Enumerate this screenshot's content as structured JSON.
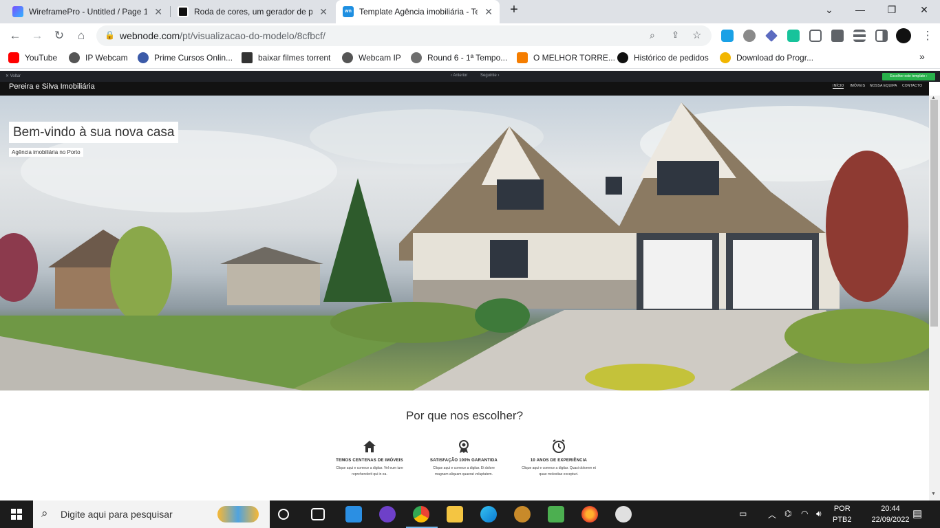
{
  "browser": {
    "tabs": [
      {
        "title": "WireframePro - Untitled / Page 1",
        "icon": "wireframepro-icon",
        "active": false
      },
      {
        "title": "Roda de cores, um gerador de pa",
        "icon": "canva-icon",
        "active": false
      },
      {
        "title": "Template Agência imobiliária - Te",
        "icon": "webnode-icon",
        "active": true
      }
    ],
    "new_tab": "+",
    "url_domain": "webnode.com",
    "url_path": "/pt/visualizacao-do-modelo/8cfbcf/",
    "bookmarks": [
      {
        "label": "YouTube",
        "color": "#ff0000"
      },
      {
        "label": "IP Webcam",
        "color": "#555555"
      },
      {
        "label": "Prime Cursos Onlin...",
        "color": "#3b5aa8"
      },
      {
        "label": "baixar filmes torrent",
        "color": "#333333"
      },
      {
        "label": "Webcam IP",
        "color": "#555555"
      },
      {
        "label": "Round 6 - 1ª Tempo...",
        "color": "#6e6e6e"
      },
      {
        "label": "O MELHOR TORRE...",
        "color": "#f57d00"
      },
      {
        "label": "Histórico de pedidos",
        "color": "#111111"
      },
      {
        "label": "Download do Progr...",
        "color": "#f2b600"
      }
    ]
  },
  "preview": {
    "back": "✕ Voltar",
    "prev": "‹ Anterior",
    "next": "Seguinte ›",
    "choose": "Escolher este template ›"
  },
  "site": {
    "brand": "Pereira e Silva Imobiliária",
    "nav": [
      "INÍCIO",
      "IMÓVEIS",
      "NOSSA EQUIPA",
      "CONTACTO"
    ],
    "hero_title": "Bem-vindo à sua nova casa",
    "hero_subtitle": "Agência imobiliária no Porto",
    "why_title": "Por que nos escolher?",
    "features": [
      {
        "icon": "house-icon",
        "heading": "TEMOS CENTENAS DE IMÓVEIS",
        "text1": "Clique aqui e comece a digitar. Vel eum iure",
        "text2": "reprehenderit qui in ea."
      },
      {
        "icon": "award-icon",
        "heading": "SATISFAÇÃO 100% GARANTIDA",
        "text1": "Clique aqui e comece a digitar. Et dolore",
        "text2": "magnam aliquam quaerat voluptatem."
      },
      {
        "icon": "clock-icon",
        "heading": "10 ANOS DE EXPERIÊNCIA",
        "text1": "Clique aqui e comece a digitar. Quasi dolorem et",
        "text2": "quae molestiae excepturi."
      }
    ]
  },
  "taskbar": {
    "search_placeholder": "Digite aqui para pesquisar",
    "lang_top": "POR",
    "lang_bottom": "PTB2",
    "time": "20:44",
    "date": "22/09/2022"
  }
}
